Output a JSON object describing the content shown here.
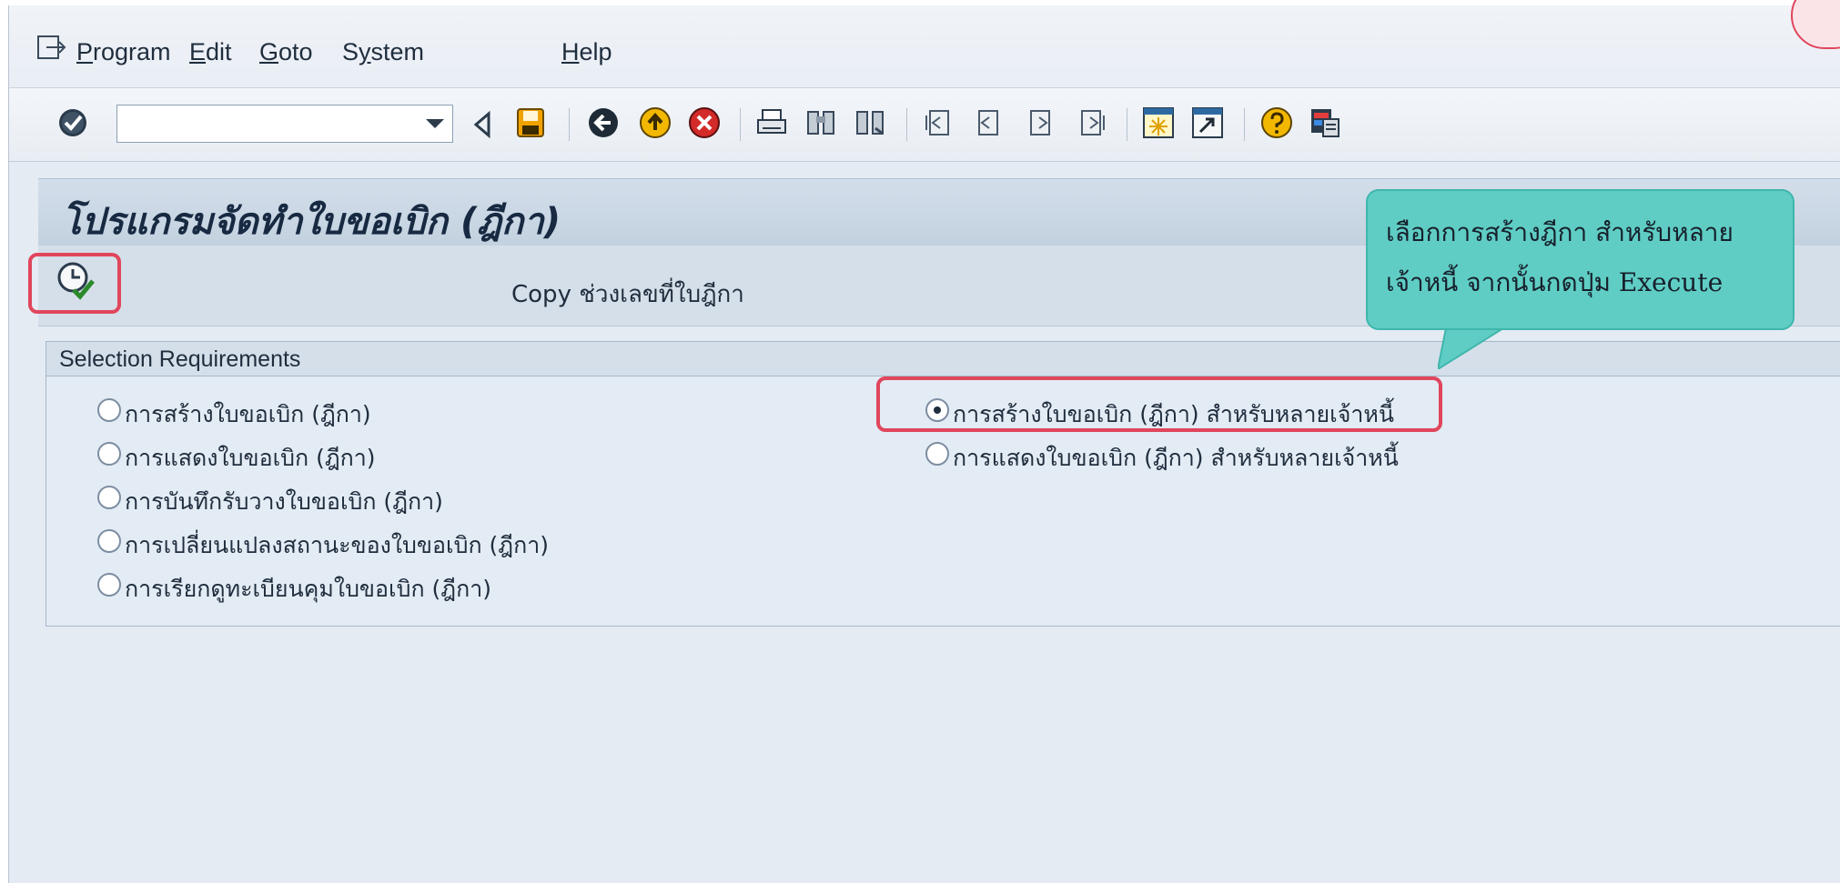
{
  "menu": {
    "items": [
      {
        "mnemonic": "P",
        "rest": "rogram"
      },
      {
        "mnemonic": "E",
        "rest": "dit"
      },
      {
        "mnemonic": "G",
        "rest": "oto"
      },
      {
        "pre": "S",
        "mnemonic": "y",
        "rest": "stem"
      },
      {
        "mnemonic": "H",
        "rest": "elp"
      }
    ]
  },
  "toolbar": {
    "command_field_value": "",
    "icons": [
      "enter-icon",
      "back-icon",
      "save-icon",
      "back-green-icon",
      "exit-icon",
      "cancel-icon",
      "print-icon",
      "find-icon",
      "find-next-icon",
      "first-page-icon",
      "previous-page-icon",
      "next-page-icon",
      "last-page-icon",
      "create-session-icon",
      "shortcut-icon",
      "help-icon",
      "customize-layout-icon"
    ]
  },
  "page": {
    "title": "โปรแกรมจัดทำใบขอเบิก (ฎีกา)"
  },
  "app_toolbar": {
    "copy_label": "Copy ช่วงเลขที่ใบฎีกา"
  },
  "selection": {
    "title": "Selection Requirements",
    "left_options": [
      {
        "label": "การสร้างใบขอเบิก (ฎีกา)",
        "selected": false
      },
      {
        "label": "การแสดงใบขอเบิก (ฎีกา)",
        "selected": false
      },
      {
        "label": "การบันทึกรับวางใบขอเบิก (ฎีกา)",
        "selected": false
      },
      {
        "label": "การเปลี่ยนแปลงสถานะของใบขอเบิก (ฎีกา)",
        "selected": false
      },
      {
        "label": "การเรียกดูทะเบียนคุมใบขอเบิก (ฎีกา)",
        "selected": false
      }
    ],
    "right_options": [
      {
        "label": "การสร้างใบขอเบิก (ฎีกา) สำหรับหลายเจ้าหนี้",
        "selected": true
      },
      {
        "label": "การแสดงใบขอเบิก (ฎีกา) สำหรับหลายเจ้าหนี้",
        "selected": false
      }
    ]
  },
  "callout": {
    "line1": "เลือกการสร้างฎีกา สำหรับหลาย",
    "line2": "เจ้าหนี้ จากนั้นกดปุ่ม Execute"
  },
  "colors": {
    "highlight": "#e0465c",
    "callout_fill": "#5fcdc4",
    "title_bar": "#c9d6e3",
    "background": "#e4ebf3"
  }
}
